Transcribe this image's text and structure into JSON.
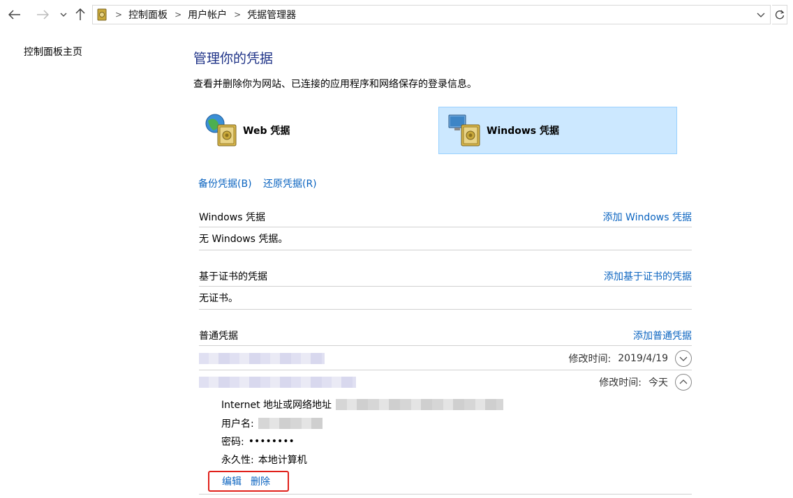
{
  "breadcrumb": [
    "控制面板",
    "用户帐户",
    "凭据管理器"
  ],
  "sidebar": {
    "home_link": "控制面板主页"
  },
  "page": {
    "title": "管理你的凭据",
    "description": "查看并删除你为网站、已连接的应用程序和网络保存的登录信息。"
  },
  "tiles": {
    "web": "Web 凭据",
    "windows": "Windows 凭据"
  },
  "links": {
    "backup": "备份凭据(B)",
    "restore": "还原凭据(R)"
  },
  "sections": {
    "windows": {
      "title": "Windows 凭据",
      "add": "添加 Windows 凭据",
      "empty": "无 Windows 凭据。"
    },
    "cert": {
      "title": "基于证书的凭据",
      "add": "添加基于证书的凭据",
      "empty": "无证书。"
    },
    "generic": {
      "title": "普通凭据",
      "add": "添加普通凭据"
    }
  },
  "generic_items": [
    {
      "modified_label": "修改时间:",
      "modified_value": "2019/4/19"
    },
    {
      "modified_label": "修改时间:",
      "modified_value": "今天"
    }
  ],
  "detail": {
    "address_label": "Internet 地址或网络地址",
    "username_label": "用户名:",
    "password_label": "密码:",
    "password_value": "••••••••",
    "persistence_label": "永久性:",
    "persistence_value": "本地计算机"
  },
  "actions": {
    "edit": "编辑",
    "delete": "删除"
  },
  "colors": {
    "accent": "#0b64c0",
    "title": "#1e3287",
    "selected_tile": "#cce8ff",
    "highlight_box": "#e0201a"
  }
}
